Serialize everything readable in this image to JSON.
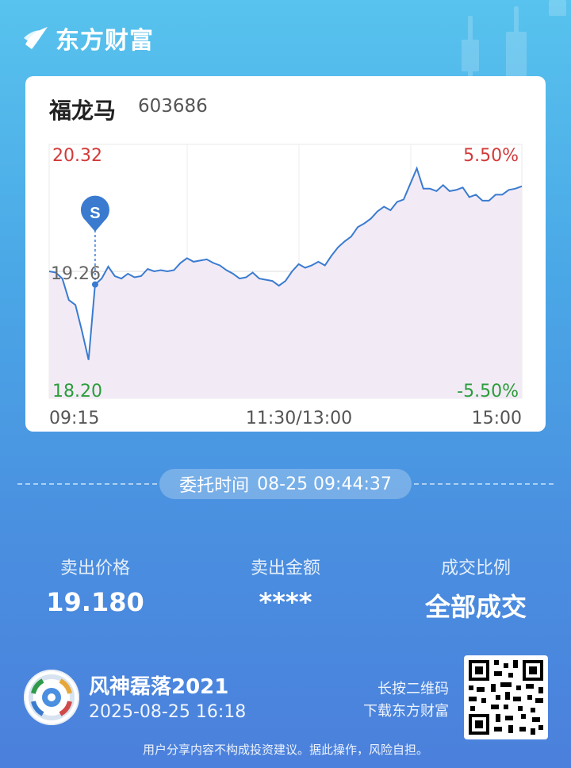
{
  "brand": {
    "name": "东方财富",
    "logo_icon": "eastmoney-logo-icon"
  },
  "stock": {
    "name": "福龙马",
    "code": "603686"
  },
  "chart_data": {
    "type": "line",
    "title": "",
    "y_left_labels": {
      "top": "20.32",
      "mid": "19.26",
      "bottom": "18.20"
    },
    "y_right_labels": {
      "top": "5.50%",
      "bottom": "-5.50%"
    },
    "x_labels": {
      "start": "09:15",
      "mid": "11:30/13:00",
      "end": "15:00"
    },
    "ylim": [
      18.2,
      20.32
    ],
    "ref_price": 19.26,
    "marker_label": "S",
    "marker_index": 7,
    "values": [
      19.26,
      19.25,
      19.2,
      19.02,
      18.98,
      18.76,
      18.52,
      19.15,
      19.2,
      19.3,
      19.22,
      19.2,
      19.24,
      19.21,
      19.22,
      19.28,
      19.26,
      19.27,
      19.26,
      19.27,
      19.33,
      19.37,
      19.34,
      19.35,
      19.36,
      19.33,
      19.31,
      19.27,
      19.24,
      19.2,
      19.21,
      19.25,
      19.2,
      19.19,
      19.18,
      19.14,
      19.18,
      19.26,
      19.32,
      19.29,
      19.31,
      19.34,
      19.31,
      19.39,
      19.46,
      19.51,
      19.55,
      19.63,
      19.66,
      19.7,
      19.76,
      19.8,
      19.77,
      19.84,
      19.86,
      19.99,
      20.12,
      19.95,
      19.95,
      19.93,
      19.98,
      19.93,
      19.94,
      19.96,
      19.88,
      19.9,
      19.85,
      19.85,
      19.9,
      19.9,
      19.94,
      19.95,
      19.97
    ],
    "colors": {
      "line": "#3a7bd0",
      "up": "#d33a3a",
      "down": "#2a9d3a",
      "area": "#f2ebf6"
    }
  },
  "order": {
    "time_label": "委托时间",
    "time_value": "08-25 09:44:37"
  },
  "stats": [
    {
      "label": "卖出价格",
      "value": "19.180"
    },
    {
      "label": "卖出金额",
      "value": "****"
    },
    {
      "label": "成交比例",
      "value": "全部成交"
    }
  ],
  "user": {
    "name": "风神磊落2021",
    "time": "2025-08-25 16:18",
    "avatar_icon": "soccer-ball-avatar-icon"
  },
  "qr": {
    "hint_line1": "长按二维码",
    "hint_line2": "下载东方财富",
    "icon": "qr-code-icon"
  },
  "disclaimer": "用户分享内容不构成投资建议。据此操作，风险自担。"
}
